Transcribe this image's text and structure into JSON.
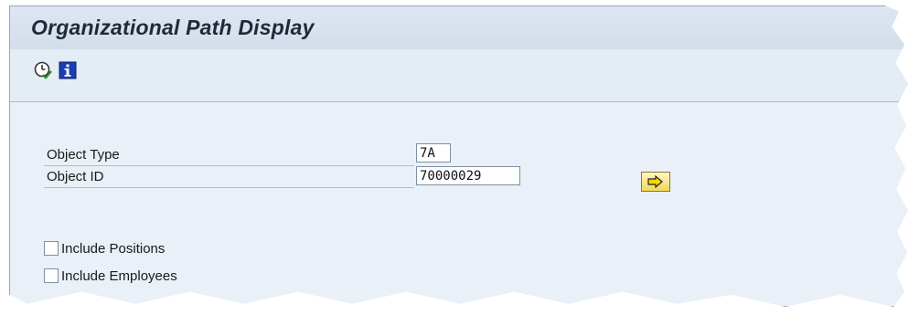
{
  "window": {
    "title": "Organizational Path Display"
  },
  "toolbar": {
    "icons": [
      "execute-clock-icon",
      "info-icon"
    ]
  },
  "form": {
    "object_type_label": "Object Type",
    "object_type_value": "7A",
    "object_id_label": "Object ID",
    "object_id_value": "70000029",
    "include_positions_label": "Include Positions",
    "include_positions_checked": false,
    "include_employees_label": "Include Employees",
    "include_employees_checked": false,
    "go_icon": "arrow-right-icon"
  },
  "colors": {
    "background": "#e6eef7",
    "button": "#f0d95a",
    "title_text": "#1e2a3a"
  }
}
